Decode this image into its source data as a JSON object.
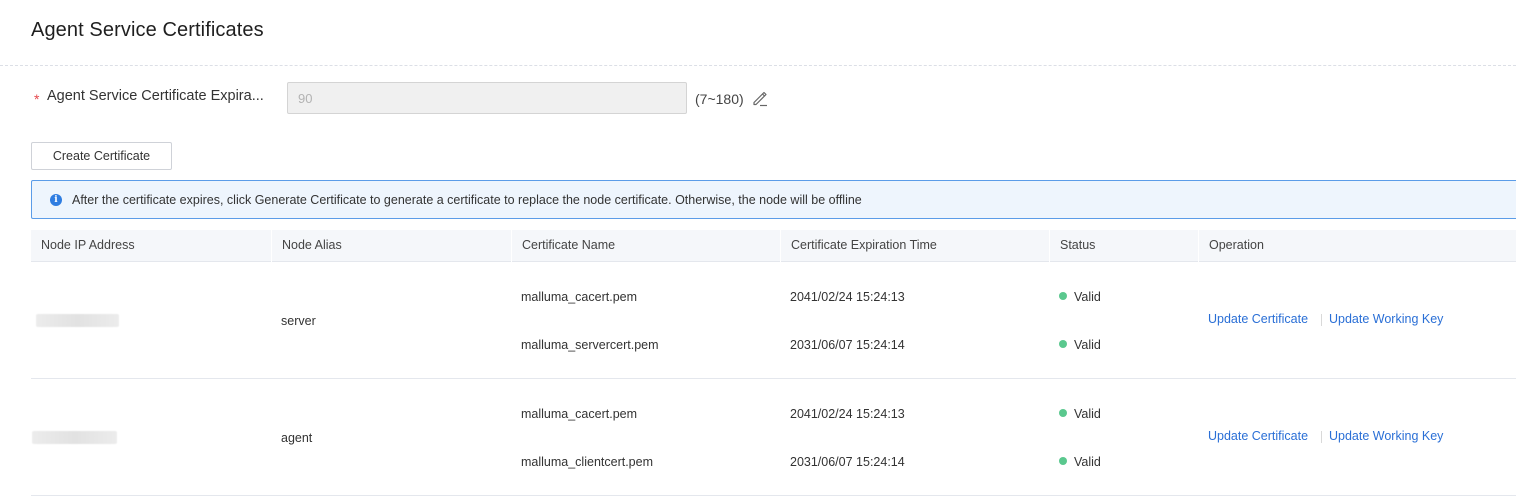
{
  "page": {
    "title": "Agent Service Certificates"
  },
  "form": {
    "required_mark": "*",
    "label": "Agent Service Certificate Expira...",
    "input_value": "90",
    "range_hint": "(7~180)"
  },
  "toolbar": {
    "create_label": "Create Certificate"
  },
  "banner": {
    "icon": "info-icon",
    "text": "After the certificate expires, click Generate Certificate to generate a certificate to replace the node certificate. Otherwise, the node will be offline"
  },
  "table": {
    "columns": [
      "Node IP Address",
      "Node Alias",
      "Certificate Name",
      "Certificate Expiration Time",
      "Status",
      "Operation"
    ],
    "rows": [
      {
        "alias": "server",
        "certs": [
          {
            "name": "malluma_cacert.pem",
            "expires": "2041/02/24 15:24:13",
            "status": "Valid"
          },
          {
            "name": "malluma_servercert.pem",
            "expires": "2031/06/07 15:24:14",
            "status": "Valid"
          }
        ],
        "ops": [
          "Update Certificate",
          "Update Working Key"
        ]
      },
      {
        "alias": "agent",
        "certs": [
          {
            "name": "malluma_cacert.pem",
            "expires": "2041/02/24 15:24:13",
            "status": "Valid"
          },
          {
            "name": "malluma_clientcert.pem",
            "expires": "2031/06/07 15:24:14",
            "status": "Valid"
          }
        ],
        "ops": [
          "Update Certificate",
          "Update Working Key"
        ]
      }
    ]
  },
  "colors": {
    "link": "#2a6fd6",
    "valid": "#5ac88e",
    "banner_border": "#5b9ce8",
    "required": "#e5484d"
  }
}
